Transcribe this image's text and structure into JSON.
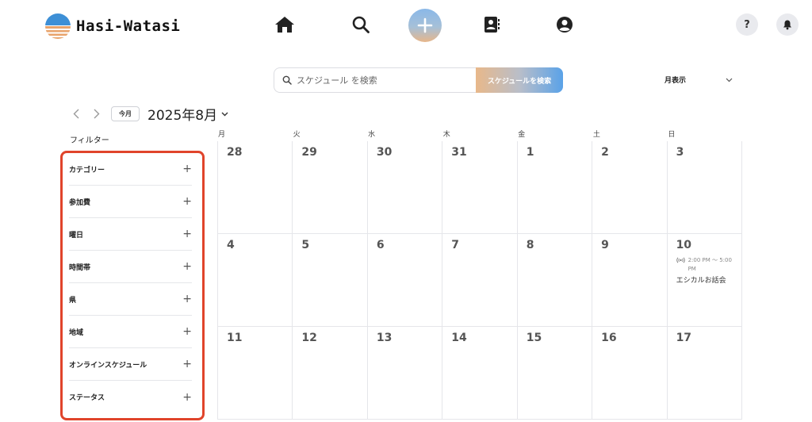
{
  "app": {
    "name": "Hasi-Watasi"
  },
  "header": {
    "nav": [
      {
        "name": "home-icon"
      },
      {
        "name": "search-icon"
      },
      {
        "name": "plus-icon"
      },
      {
        "name": "contacts-icon"
      },
      {
        "name": "account-icon"
      }
    ],
    "help_label": "?",
    "bell_icon": "bell-icon"
  },
  "search": {
    "placeholder": "スケジュール を検索",
    "value": "",
    "button_label": "スケジュールを検索"
  },
  "view_select": {
    "selected": "月表示"
  },
  "month_nav": {
    "today_label": "今月",
    "month_label": "2025年8月"
  },
  "filter": {
    "title": "フィルター",
    "items": [
      {
        "label": "カテゴリー"
      },
      {
        "label": "参加費"
      },
      {
        "label": "曜日"
      },
      {
        "label": "時間帯"
      },
      {
        "label": "県"
      },
      {
        "label": "地域"
      },
      {
        "label": "オンラインスケジュール"
      },
      {
        "label": "ステータス"
      }
    ]
  },
  "calendar": {
    "weekdays": [
      "月",
      "火",
      "水",
      "木",
      "金",
      "土",
      "日"
    ],
    "days": [
      "28",
      "29",
      "30",
      "31",
      "1",
      "2",
      "3",
      "4",
      "5",
      "6",
      "7",
      "8",
      "9",
      "10",
      "11",
      "12",
      "13",
      "14",
      "15",
      "16",
      "17"
    ],
    "event": {
      "time": "2:00 PM 〜 5:00 PM",
      "title": "エシカルお話会",
      "icon": "broadcast-icon"
    }
  },
  "colors": {
    "accent_blue": "#5aa2e8",
    "accent_orange": "#e8b88a",
    "highlight_red": "#e0442b"
  }
}
